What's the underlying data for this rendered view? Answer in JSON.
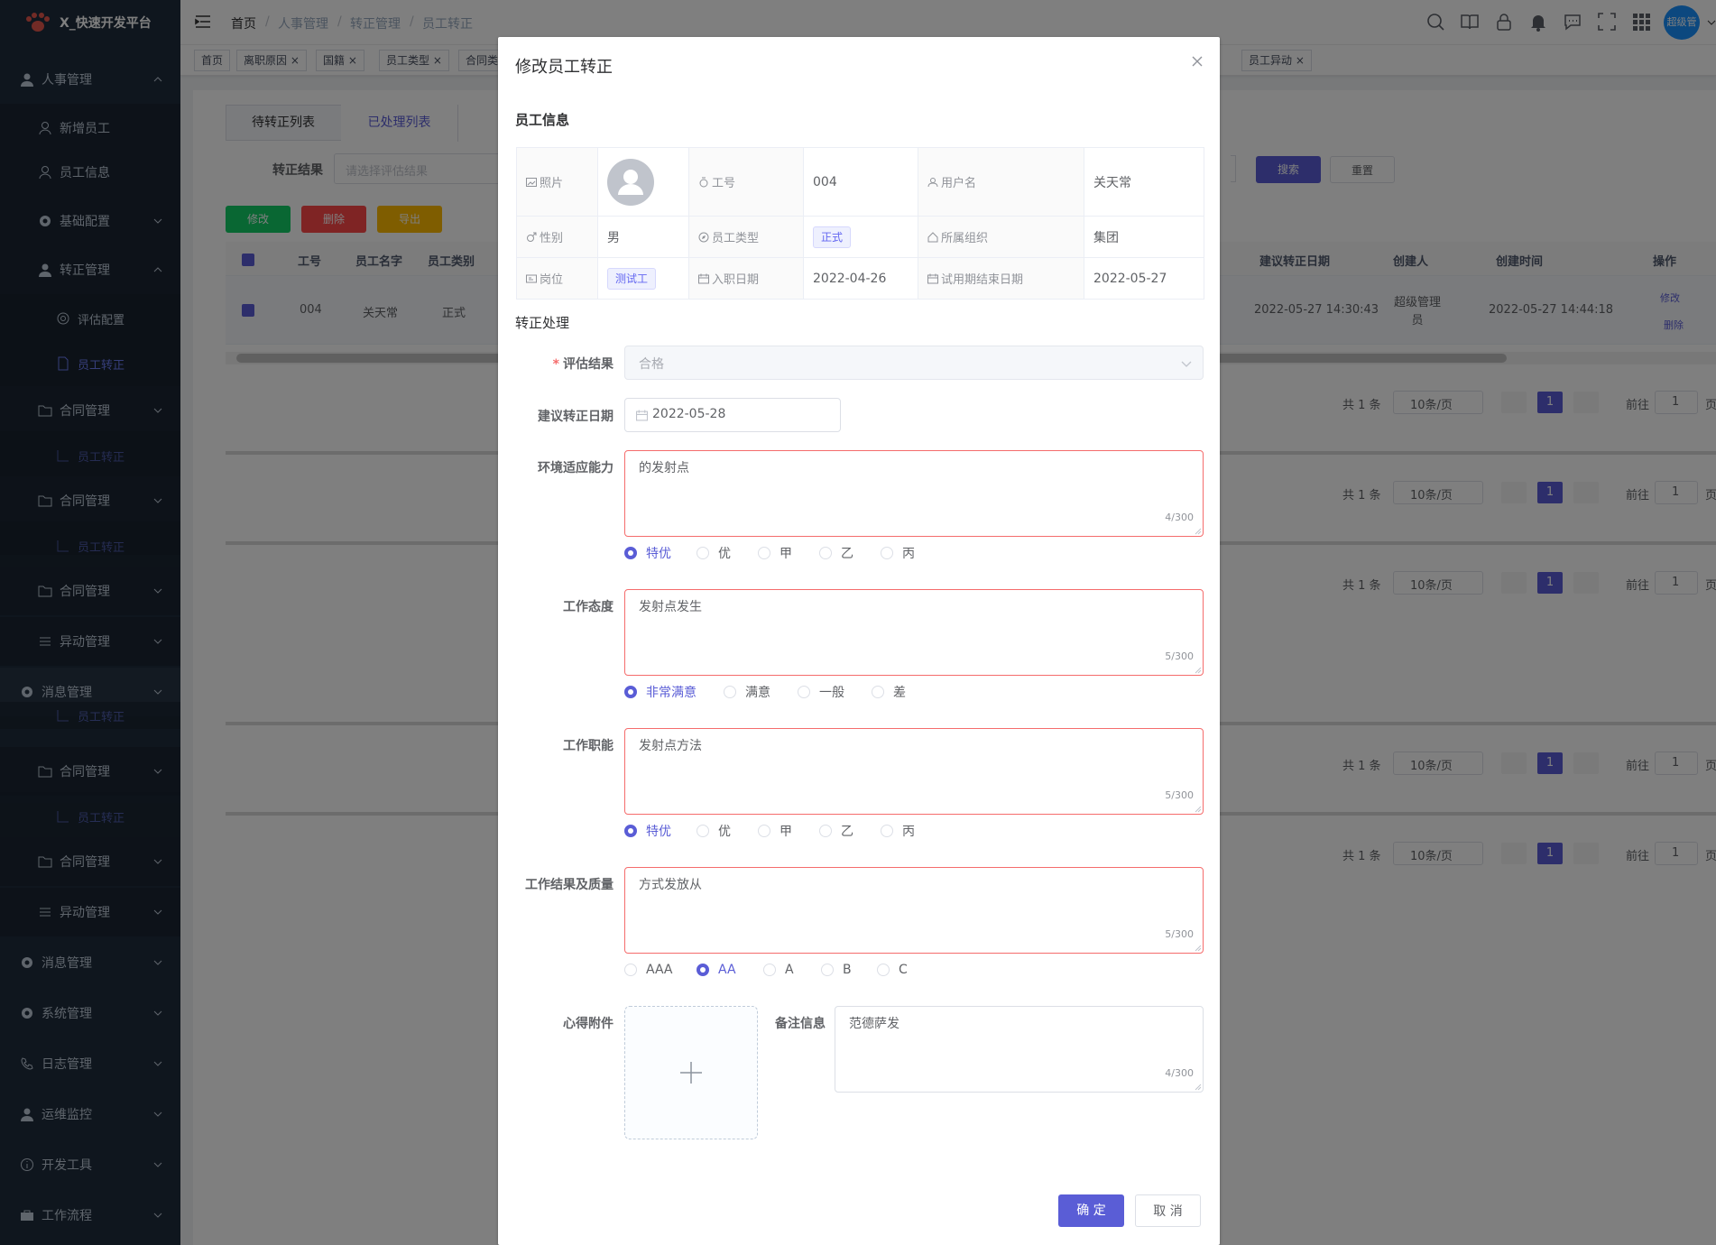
{
  "app": {
    "title": "X_快速开发平台",
    "user": "超级管"
  },
  "sidebar": {
    "items": [
      {
        "label": "人事管理"
      },
      {
        "label": "新增员工"
      },
      {
        "label": "员工信息"
      },
      {
        "label": "基础配置"
      },
      {
        "label": "转正管理"
      },
      {
        "label": "评估配置"
      },
      {
        "label": "员工转正"
      },
      {
        "label": "合同管理"
      },
      {
        "label": "员工转正"
      },
      {
        "label": "合同管理"
      },
      {
        "label": "员工转正"
      },
      {
        "label": "合同管理"
      },
      {
        "label": "异动管理"
      },
      {
        "label": "消息管理"
      },
      {
        "label": "员工转正"
      },
      {
        "label": "合同管理"
      },
      {
        "label": "员工转正"
      },
      {
        "label": "合同管理"
      },
      {
        "label": "异动管理"
      },
      {
        "label": "消息管理"
      },
      {
        "label": "系统管理"
      },
      {
        "label": "日志管理"
      },
      {
        "label": "运维监控"
      },
      {
        "label": "开发工具"
      },
      {
        "label": "工作流程"
      }
    ]
  },
  "breadcrumb": {
    "items": [
      "首页",
      "人事管理",
      "转正管理",
      "员工转正"
    ],
    "sep": "/"
  },
  "tags": {
    "items": [
      "首页",
      "离职原因 ×",
      "国籍 ×",
      "员工类型 ×",
      "合同类",
      "员工异动 ×"
    ]
  },
  "page": {
    "tabs": [
      "待转正列表",
      "已处理列表"
    ],
    "filter_label": "转正结果",
    "filter_placeholder": "请选择评估结果",
    "search_btn": "搜索",
    "reset_btn": "重置",
    "edit_btn": "修改",
    "delete_btn": "删除",
    "export_btn": "导出",
    "columns": [
      "工号",
      "员工名字",
      "员工类别",
      "建议转正日期",
      "创建人",
      "创建时间",
      "操作"
    ],
    "row": {
      "id": "004",
      "name": "关天常",
      "type": "正式",
      "suggest_date": "2022-05-27 14:30:43",
      "creator": "超级管理员",
      "created": "2022-05-27 14:44:18",
      "op_edit": "修改",
      "op_delete": "删除"
    },
    "pagination": {
      "total": "共 1 条",
      "size": "10条/页",
      "current": "1",
      "goto": "前往",
      "goto_val": "1",
      "page_unit": "页"
    }
  },
  "dialog": {
    "title": "修改员工转正",
    "section_info": "员工信息",
    "info": {
      "photo_label": "照片",
      "id_label": "工号",
      "id": "004",
      "username_label": "用户名",
      "username": "关天常",
      "gender_label": "性别",
      "gender": "男",
      "type_label": "员工类型",
      "type": "正式",
      "org_label": "所属组织",
      "org": "集团",
      "post_label": "岗位",
      "post": "测试工",
      "join_label": "入职日期",
      "join": "2022-04-26",
      "trial_label": "试用期结束日期",
      "trial": "2022-05-27"
    },
    "section_process": "转正处理",
    "result_label": "评估结果",
    "result_value": "合格",
    "date_label": "建议转正日期",
    "date_value": "2022-05-28",
    "env_label": "环境适应能力",
    "env_text": "的发射点",
    "env_count": "4/300",
    "env_options": [
      "特优",
      "优",
      "甲",
      "乙",
      "丙"
    ],
    "attitude_label": "工作态度",
    "attitude_text": "发射点发生",
    "attitude_count": "5/300",
    "attitude_options": [
      "非常满意",
      "满意",
      "一般",
      "差"
    ],
    "duty_label": "工作职能",
    "duty_text": "发射点方法",
    "duty_count": "5/300",
    "duty_options": [
      "特优",
      "优",
      "甲",
      "乙",
      "丙"
    ],
    "quality_label": "工作结果及质量",
    "quality_text": "方式发放从",
    "quality_count": "5/300",
    "quality_options": [
      "AAA",
      "AA",
      "A",
      "B",
      "C"
    ],
    "attach_label": "心得附件",
    "remark_label": "备注信息",
    "remark_text": "范德萨发",
    "remark_count": "4/300",
    "confirm": "确 定",
    "cancel": "取 消"
  },
  "colors": {
    "accent": "#5a5dd6",
    "sidebar": "#1f2d3d",
    "danger": "#f56c6c",
    "success": "#13ce66"
  }
}
